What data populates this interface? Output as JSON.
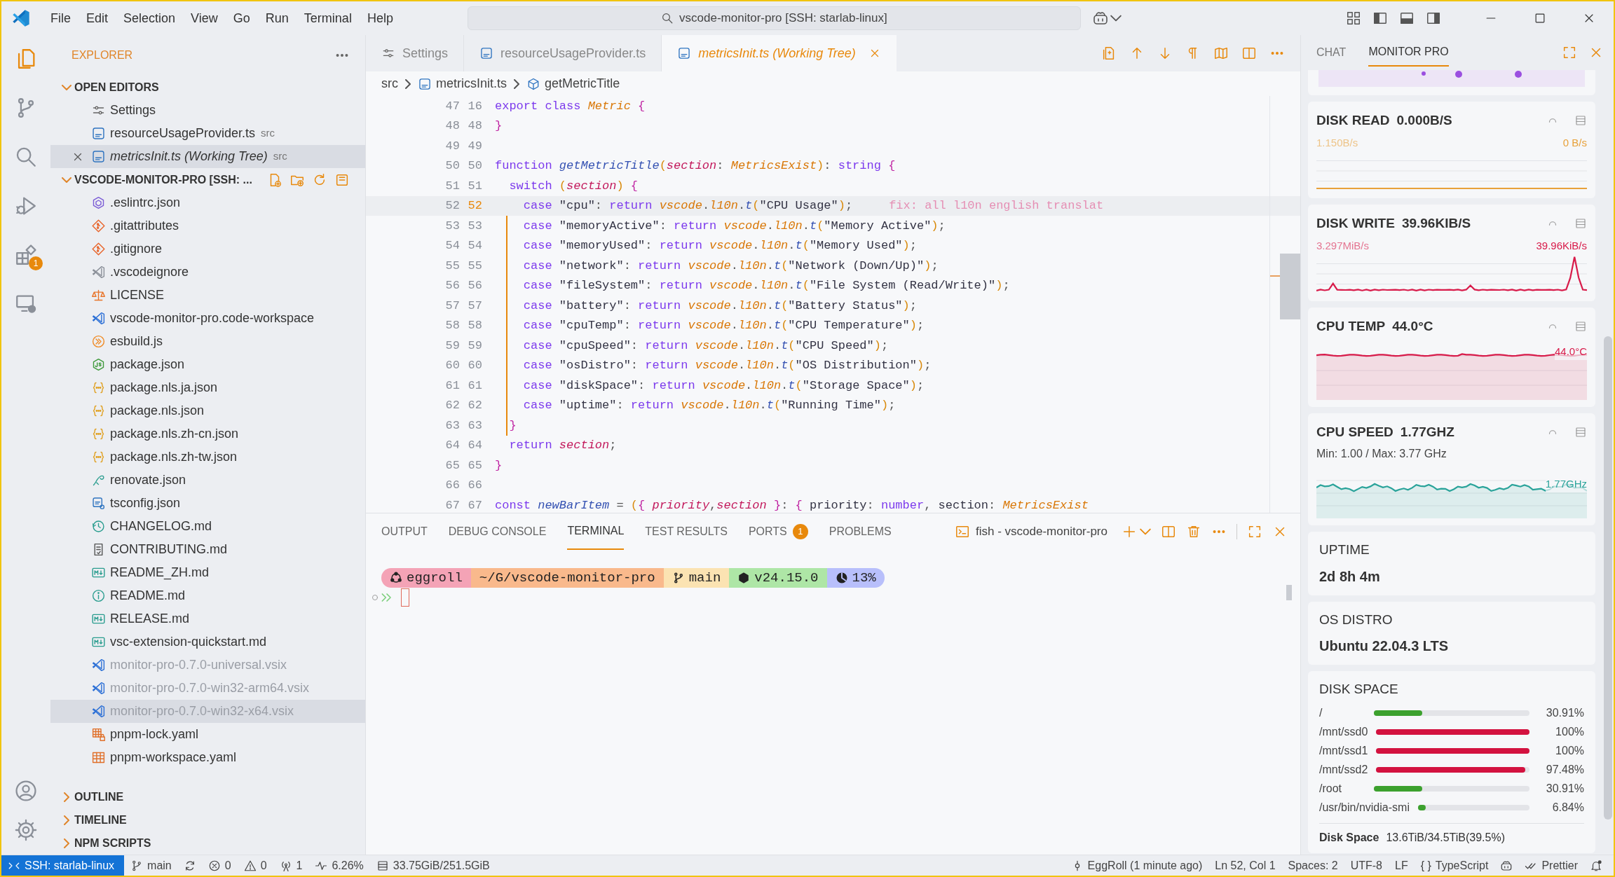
{
  "title_bar": {
    "menu": [
      "File",
      "Edit",
      "Selection",
      "View",
      "Go",
      "Run",
      "Terminal",
      "Help"
    ],
    "search": "vscode-monitor-pro [SSH: starlab-linux]"
  },
  "activity_bar": [
    {
      "kind": "explorer",
      "selected": true
    },
    {
      "kind": "source-control",
      "selected": false
    },
    {
      "kind": "search",
      "selected": false
    },
    {
      "kind": "run-debug",
      "selected": false
    },
    {
      "kind": "extensions",
      "selected": false,
      "badge": "1"
    },
    {
      "kind": "remote",
      "selected": false
    }
  ],
  "sidebar": {
    "title": "EXPLORER",
    "sections": [
      {
        "label": "OPEN EDITORS",
        "expanded": true,
        "items": [
          {
            "kind": "settings",
            "label": "Settings",
            "selected": false,
            "preview": false
          },
          {
            "kind": "typescript",
            "label": "resourceUsageProvider.ts",
            "detail": "src",
            "selected": false,
            "preview": false
          },
          {
            "kind": "typescript",
            "label": "metricsInit.ts (Working Tree)",
            "detail": "src",
            "selected": true,
            "preview": true
          }
        ]
      },
      {
        "label": "VSCODE-MONITOR-PRO [SSH: ...",
        "expanded": true,
        "items": [
          {
            "kind": "eslint",
            "label": ".eslintrc.json",
            "selected": false,
            "dimmed": false
          },
          {
            "kind": "git",
            "label": ".gitattributes",
            "selected": false,
            "dimmed": false
          },
          {
            "kind": "git",
            "label": ".gitignore",
            "selected": false,
            "dimmed": false
          },
          {
            "kind": "vscode-grey",
            "label": ".vscodeignore",
            "selected": false,
            "dimmed": false
          },
          {
            "kind": "license",
            "label": "LICENSE",
            "selected": false,
            "dimmed": false
          },
          {
            "kind": "vscode",
            "label": "vscode-monitor-pro.code-workspace",
            "selected": false,
            "dimmed": false
          },
          {
            "kind": "esbuild",
            "label": "esbuild.js",
            "selected": false,
            "dimmed": false
          },
          {
            "kind": "node",
            "label": "package.json",
            "selected": false,
            "dimmed": false
          },
          {
            "kind": "json",
            "label": "package.nls.ja.json",
            "selected": false,
            "dimmed": false
          },
          {
            "kind": "json",
            "label": "package.nls.json",
            "selected": false,
            "dimmed": false
          },
          {
            "kind": "json",
            "label": "package.nls.zh-cn.json",
            "selected": false,
            "dimmed": false
          },
          {
            "kind": "json",
            "label": "package.nls.zh-tw.json",
            "selected": false,
            "dimmed": false
          },
          {
            "kind": "renovate",
            "label": "renovate.json",
            "selected": false,
            "dimmed": false
          },
          {
            "kind": "tsconfig",
            "label": "tsconfig.json",
            "selected": false,
            "dimmed": false
          },
          {
            "kind": "changelog",
            "label": "CHANGELOG.md",
            "selected": false,
            "dimmed": false
          },
          {
            "kind": "contributing",
            "label": "CONTRIBUTING.md",
            "selected": false,
            "dimmed": false
          },
          {
            "kind": "markdown",
            "label": "README_ZH.md",
            "selected": false,
            "dimmed": false
          },
          {
            "kind": "info",
            "label": "README.md",
            "selected": false,
            "dimmed": false
          },
          {
            "kind": "markdown",
            "label": "RELEASE.md",
            "selected": false,
            "dimmed": false
          },
          {
            "kind": "markdown",
            "label": "vsc-extension-quickstart.md",
            "selected": false,
            "dimmed": false
          },
          {
            "kind": "vscode",
            "label": "monitor-pro-0.7.0-universal.vsix",
            "selected": false,
            "dimmed": true
          },
          {
            "kind": "vscode",
            "label": "monitor-pro-0.7.0-win32-arm64.vsix",
            "selected": false,
            "dimmed": true
          },
          {
            "kind": "vscode",
            "label": "monitor-pro-0.7.0-win32-x64.vsix",
            "selected": true,
            "dimmed": true
          },
          {
            "kind": "table-lock",
            "label": "pnpm-lock.yaml",
            "selected": false,
            "dimmed": false
          },
          {
            "kind": "table",
            "label": "pnpm-workspace.yaml",
            "selected": false,
            "dimmed": false
          }
        ]
      },
      {
        "label": "OUTLINE",
        "expanded": false
      },
      {
        "label": "TIMELINE",
        "expanded": false
      },
      {
        "label": "NPM SCRIPTS",
        "expanded": false
      }
    ]
  },
  "editor": {
    "tabs": [
      {
        "kind": "settings",
        "label": "Settings",
        "selected": false
      },
      {
        "kind": "typescript",
        "label": "resourceUsageProvider.ts",
        "selected": false
      },
      {
        "kind": "typescript",
        "label": "metricsInit.ts (Working Tree)",
        "selected": true
      }
    ],
    "breadcrumb": [
      {
        "kind": "folder",
        "label": "src"
      },
      {
        "kind": "typescript",
        "label": "metricsInit.ts"
      },
      {
        "kind": "symbol",
        "label": "getMetricTitle"
      }
    ],
    "lines": [
      {
        "old": "47",
        "new": "16",
        "current": false,
        "tokens": [
          {
            "text": "export ",
            "kind": "kw"
          },
          {
            "text": "class ",
            "kind": "kw"
          },
          {
            "text": "Metric ",
            "kind": "type"
          },
          {
            "text": "{",
            "kind": "brace"
          }
        ]
      },
      {
        "old": "48",
        "new": "48",
        "current": false,
        "tokens": [
          {
            "text": "}",
            "kind": "brace"
          }
        ]
      },
      {
        "old": "49",
        "new": "49",
        "current": false
      },
      {
        "old": "50",
        "new": "50",
        "current": false,
        "tokens": [
          {
            "text": "function ",
            "kind": "kw"
          },
          {
            "text": "getMetricTitle",
            "kind": "fn"
          },
          {
            "text": "(",
            "kind": "paren"
          },
          {
            "text": "section",
            "kind": "param"
          },
          {
            "text": ": ",
            "kind": "punct"
          },
          {
            "text": "MetricsExist",
            "kind": "type"
          },
          {
            "text": ")",
            "kind": "paren"
          },
          {
            "text": ": ",
            "kind": "punct"
          },
          {
            "text": "string ",
            "kind": "kw"
          },
          {
            "text": "{",
            "kind": "brace"
          }
        ]
      },
      {
        "old": "51",
        "new": "51",
        "current": false,
        "tokens": [
          {
            "text": "  switch ",
            "kind": "kw"
          },
          {
            "text": "(",
            "kind": "paren"
          },
          {
            "text": "section",
            "kind": "param"
          },
          {
            "text": ") ",
            "kind": "paren"
          },
          {
            "text": "{",
            "kind": "brace"
          }
        ]
      },
      {
        "old": "52",
        "new": "52",
        "current": true,
        "annotation": "fix: all l10n english translat",
        "tokens": [
          {
            "text": "    case ",
            "kind": "kw"
          },
          {
            "text": "\"cpu\"",
            "kind": "str"
          },
          {
            "text": ": ",
            "kind": "punct"
          },
          {
            "text": "return ",
            "kind": "kw"
          },
          {
            "text": "vscode",
            "kind": "var"
          },
          {
            "text": ".",
            "kind": "punct"
          },
          {
            "text": "l10n",
            "kind": "var"
          },
          {
            "text": ".",
            "kind": "punct"
          },
          {
            "text": "t",
            "kind": "fn"
          },
          {
            "text": "(",
            "kind": "paren"
          },
          {
            "text": "\"CPU Usage\"",
            "kind": "str"
          },
          {
            "text": ")",
            "kind": "paren"
          },
          {
            "text": ";",
            "kind": "punct"
          }
        ]
      },
      {
        "old": "53",
        "new": "53",
        "current": false,
        "tokens": [
          {
            "text": "    case ",
            "kind": "kw"
          },
          {
            "text": "\"memoryActive\"",
            "kind": "str"
          },
          {
            "text": ": ",
            "kind": "punct"
          },
          {
            "text": "return ",
            "kind": "kw"
          },
          {
            "text": "vscode",
            "kind": "var"
          },
          {
            "text": ".",
            "kind": "punct"
          },
          {
            "text": "l10n",
            "kind": "var"
          },
          {
            "text": ".",
            "kind": "punct"
          },
          {
            "text": "t",
            "kind": "fn"
          },
          {
            "text": "(",
            "kind": "paren"
          },
          {
            "text": "\"Memory Active\"",
            "kind": "str"
          },
          {
            "text": ")",
            "kind": "paren"
          },
          {
            "text": ";",
            "kind": "punct"
          }
        ]
      },
      {
        "old": "54",
        "new": "54",
        "current": false,
        "tokens": [
          {
            "text": "    case ",
            "kind": "kw"
          },
          {
            "text": "\"memoryUsed\"",
            "kind": "str"
          },
          {
            "text": ": ",
            "kind": "punct"
          },
          {
            "text": "return ",
            "kind": "kw"
          },
          {
            "text": "vscode",
            "kind": "var"
          },
          {
            "text": ".",
            "kind": "punct"
          },
          {
            "text": "l10n",
            "kind": "var"
          },
          {
            "text": ".",
            "kind": "punct"
          },
          {
            "text": "t",
            "kind": "fn"
          },
          {
            "text": "(",
            "kind": "paren"
          },
          {
            "text": "\"Memory Used\"",
            "kind": "str"
          },
          {
            "text": ")",
            "kind": "paren"
          },
          {
            "text": ";",
            "kind": "punct"
          }
        ]
      },
      {
        "old": "55",
        "new": "55",
        "current": false,
        "tokens": [
          {
            "text": "    case ",
            "kind": "kw"
          },
          {
            "text": "\"network\"",
            "kind": "str"
          },
          {
            "text": ": ",
            "kind": "punct"
          },
          {
            "text": "return ",
            "kind": "kw"
          },
          {
            "text": "vscode",
            "kind": "var"
          },
          {
            "text": ".",
            "kind": "punct"
          },
          {
            "text": "l10n",
            "kind": "var"
          },
          {
            "text": ".",
            "kind": "punct"
          },
          {
            "text": "t",
            "kind": "fn"
          },
          {
            "text": "(",
            "kind": "paren"
          },
          {
            "text": "\"Network (Down/Up)\"",
            "kind": "str"
          },
          {
            "text": ")",
            "kind": "paren"
          },
          {
            "text": ";",
            "kind": "punct"
          }
        ]
      },
      {
        "old": "56",
        "new": "56",
        "current": false,
        "tokens": [
          {
            "text": "    case ",
            "kind": "kw"
          },
          {
            "text": "\"fileSystem\"",
            "kind": "str"
          },
          {
            "text": ": ",
            "kind": "punct"
          },
          {
            "text": "return ",
            "kind": "kw"
          },
          {
            "text": "vscode",
            "kind": "var"
          },
          {
            "text": ".",
            "kind": "punct"
          },
          {
            "text": "l10n",
            "kind": "var"
          },
          {
            "text": ".",
            "kind": "punct"
          },
          {
            "text": "t",
            "kind": "fn"
          },
          {
            "text": "(",
            "kind": "paren"
          },
          {
            "text": "\"File System (Read/Write)\"",
            "kind": "str"
          },
          {
            "text": ")",
            "kind": "paren"
          },
          {
            "text": ";",
            "kind": "punct"
          }
        ]
      },
      {
        "old": "57",
        "new": "57",
        "current": false,
        "tokens": [
          {
            "text": "    case ",
            "kind": "kw"
          },
          {
            "text": "\"battery\"",
            "kind": "str"
          },
          {
            "text": ": ",
            "kind": "punct"
          },
          {
            "text": "return ",
            "kind": "kw"
          },
          {
            "text": "vscode",
            "kind": "var"
          },
          {
            "text": ".",
            "kind": "punct"
          },
          {
            "text": "l10n",
            "kind": "var"
          },
          {
            "text": ".",
            "kind": "punct"
          },
          {
            "text": "t",
            "kind": "fn"
          },
          {
            "text": "(",
            "kind": "paren"
          },
          {
            "text": "\"Battery Status\"",
            "kind": "str"
          },
          {
            "text": ")",
            "kind": "paren"
          },
          {
            "text": ";",
            "kind": "punct"
          }
        ]
      },
      {
        "old": "58",
        "new": "58",
        "current": false,
        "tokens": [
          {
            "text": "    case ",
            "kind": "kw"
          },
          {
            "text": "\"cpuTemp\"",
            "kind": "str"
          },
          {
            "text": ": ",
            "kind": "punct"
          },
          {
            "text": "return ",
            "kind": "kw"
          },
          {
            "text": "vscode",
            "kind": "var"
          },
          {
            "text": ".",
            "kind": "punct"
          },
          {
            "text": "l10n",
            "kind": "var"
          },
          {
            "text": ".",
            "kind": "punct"
          },
          {
            "text": "t",
            "kind": "fn"
          },
          {
            "text": "(",
            "kind": "paren"
          },
          {
            "text": "\"CPU Temperature\"",
            "kind": "str"
          },
          {
            "text": ")",
            "kind": "paren"
          },
          {
            "text": ";",
            "kind": "punct"
          }
        ]
      },
      {
        "old": "59",
        "new": "59",
        "current": false,
        "tokens": [
          {
            "text": "    case ",
            "kind": "kw"
          },
          {
            "text": "\"cpuSpeed\"",
            "kind": "str"
          },
          {
            "text": ": ",
            "kind": "punct"
          },
          {
            "text": "return ",
            "kind": "kw"
          },
          {
            "text": "vscode",
            "kind": "var"
          },
          {
            "text": ".",
            "kind": "punct"
          },
          {
            "text": "l10n",
            "kind": "var"
          },
          {
            "text": ".",
            "kind": "punct"
          },
          {
            "text": "t",
            "kind": "fn"
          },
          {
            "text": "(",
            "kind": "paren"
          },
          {
            "text": "\"CPU Speed\"",
            "kind": "str"
          },
          {
            "text": ")",
            "kind": "paren"
          },
          {
            "text": ";",
            "kind": "punct"
          }
        ]
      },
      {
        "old": "60",
        "new": "60",
        "current": false,
        "tokens": [
          {
            "text": "    case ",
            "kind": "kw"
          },
          {
            "text": "\"osDistro\"",
            "kind": "str"
          },
          {
            "text": ": ",
            "kind": "punct"
          },
          {
            "text": "return ",
            "kind": "kw"
          },
          {
            "text": "vscode",
            "kind": "var"
          },
          {
            "text": ".",
            "kind": "punct"
          },
          {
            "text": "l10n",
            "kind": "var"
          },
          {
            "text": ".",
            "kind": "punct"
          },
          {
            "text": "t",
            "kind": "fn"
          },
          {
            "text": "(",
            "kind": "paren"
          },
          {
            "text": "\"OS Distribution\"",
            "kind": "str"
          },
          {
            "text": ")",
            "kind": "paren"
          },
          {
            "text": ";",
            "kind": "punct"
          }
        ]
      },
      {
        "old": "61",
        "new": "61",
        "current": false,
        "tokens": [
          {
            "text": "    case ",
            "kind": "kw"
          },
          {
            "text": "\"diskSpace\"",
            "kind": "str"
          },
          {
            "text": ": ",
            "kind": "punct"
          },
          {
            "text": "return ",
            "kind": "kw"
          },
          {
            "text": "vscode",
            "kind": "var"
          },
          {
            "text": ".",
            "kind": "punct"
          },
          {
            "text": "l10n",
            "kind": "var"
          },
          {
            "text": ".",
            "kind": "punct"
          },
          {
            "text": "t",
            "kind": "fn"
          },
          {
            "text": "(",
            "kind": "paren"
          },
          {
            "text": "\"Storage Space\"",
            "kind": "str"
          },
          {
            "text": ")",
            "kind": "paren"
          },
          {
            "text": ";",
            "kind": "punct"
          }
        ]
      },
      {
        "old": "62",
        "new": "62",
        "current": false,
        "tokens": [
          {
            "text": "    case ",
            "kind": "kw"
          },
          {
            "text": "\"uptime\"",
            "kind": "str"
          },
          {
            "text": ": ",
            "kind": "punct"
          },
          {
            "text": "return ",
            "kind": "kw"
          },
          {
            "text": "vscode",
            "kind": "var"
          },
          {
            "text": ".",
            "kind": "punct"
          },
          {
            "text": "l10n",
            "kind": "var"
          },
          {
            "text": ".",
            "kind": "punct"
          },
          {
            "text": "t",
            "kind": "fn"
          },
          {
            "text": "(",
            "kind": "paren"
          },
          {
            "text": "\"Running Time\"",
            "kind": "str"
          },
          {
            "text": ")",
            "kind": "paren"
          },
          {
            "text": ";",
            "kind": "punct"
          }
        ]
      },
      {
        "old": "63",
        "new": "63",
        "current": false,
        "tokens": [
          {
            "text": "  }",
            "kind": "brace"
          }
        ]
      },
      {
        "old": "64",
        "new": "64",
        "current": false,
        "tokens": [
          {
            "text": "  return ",
            "kind": "kw"
          },
          {
            "text": "section",
            "kind": "param"
          },
          {
            "text": ";",
            "kind": "punct"
          }
        ]
      },
      {
        "old": "65",
        "new": "65",
        "current": false,
        "tokens": [
          {
            "text": "}",
            "kind": "brace"
          }
        ]
      },
      {
        "old": "66",
        "new": "66",
        "current": false
      },
      {
        "old": "67",
        "new": "67",
        "current": false,
        "tokens": [
          {
            "text": "const ",
            "kind": "kw"
          },
          {
            "text": "newBarItem",
            "kind": "fn"
          },
          {
            "text": " = ",
            "kind": "punct"
          },
          {
            "text": "(",
            "kind": "paren"
          },
          {
            "text": "{ ",
            "kind": "brace"
          },
          {
            "text": "priority",
            "kind": "param"
          },
          {
            "text": ",",
            "kind": "punct"
          },
          {
            "text": "section ",
            "kind": "param"
          },
          {
            "text": "}",
            "kind": "brace"
          },
          {
            "text": ": ",
            "kind": "punct"
          },
          {
            "text": "{ ",
            "kind": "brace"
          },
          {
            "text": "priority",
            "kind": "prop"
          },
          {
            "text": ": ",
            "kind": "punct"
          },
          {
            "text": "number",
            "kind": "kw"
          },
          {
            "text": ", ",
            "kind": "punct"
          },
          {
            "text": "section",
            "kind": "prop"
          },
          {
            "text": ": ",
            "kind": "punct"
          },
          {
            "text": "MetricsExist",
            "kind": "type"
          }
        ]
      }
    ]
  },
  "panel": {
    "tabs": [
      {
        "label": "OUTPUT",
        "selected": false
      },
      {
        "label": "DEBUG CONSOLE",
        "selected": false
      },
      {
        "label": "TERMINAL",
        "selected": true
      },
      {
        "label": "TEST RESULTS",
        "selected": false
      },
      {
        "label": "PORTS",
        "selected": false,
        "badge": "1"
      },
      {
        "label": "PROBLEMS",
        "selected": false
      }
    ],
    "terminal_title": "fish - vscode-monitor-pro",
    "prompt": [
      {
        "kind": "user",
        "text": "eggroll",
        "color": "#f4a3b6"
      },
      {
        "kind": "path",
        "text": "~/G/vscode-monitor-pro",
        "color": "#f9b98c"
      },
      {
        "kind": "branch",
        "text": "main",
        "color": "#fbe3b2"
      },
      {
        "kind": "node",
        "text": "v24.15.0",
        "color": "#aee6a6"
      },
      {
        "kind": "pie",
        "text": "13%",
        "color": "#b8bffb"
      }
    ]
  },
  "right_panel": {
    "tabs": [
      {
        "label": "CHAT",
        "selected": false
      },
      {
        "label": "MONITOR PRO",
        "selected": true
      }
    ],
    "cards": [
      {
        "kind": "chart_cut",
        "color": "#9b4fe0"
      },
      {
        "kind": "chart",
        "title": "DISK READ",
        "value": "0.000B/S",
        "max_label": "1.150B/s",
        "current_label": "0 B/s",
        "color": "#e8a13a",
        "filled": false
      },
      {
        "kind": "chart",
        "title": "DISK WRITE",
        "value": "39.96KIB/S",
        "max_label": "3.297MiB/s",
        "current_label": "39.96KiB/s",
        "color": "#d81b4a",
        "filled": false
      },
      {
        "kind": "chart",
        "title": "CPU TEMP",
        "value": "44.0°C",
        "end_label": "44.0°C",
        "color": "#d81b4a",
        "filled": true
      },
      {
        "kind": "chart",
        "title": "CPU SPEED",
        "value": "1.77GHZ",
        "subtitle": "Min: 1.00 / Max: 3.77 GHz",
        "end_label": "1.77GHz",
        "color": "#2aa39a",
        "filled": true
      },
      {
        "kind": "text",
        "title": "UPTIME",
        "value": "2d 8h 4m"
      },
      {
        "kind": "text",
        "title": "OS DISTRO",
        "value": "Ubuntu 22.04.3 LTS"
      },
      {
        "kind": "disk",
        "title": "DISK SPACE",
        "rows": [
          {
            "mount": "/",
            "level": 0.3091,
            "percent": "30.91%",
            "color": "#3ca12e"
          },
          {
            "mount": "/mnt/ssd0",
            "level": 1,
            "percent": "100%",
            "color": "#d3123f"
          },
          {
            "mount": "/mnt/ssd1",
            "level": 1,
            "percent": "100%",
            "color": "#d3123f"
          },
          {
            "mount": "/mnt/ssd2",
            "level": 0.9748,
            "percent": "97.48%",
            "color": "#d3123f"
          },
          {
            "mount": "/root",
            "level": 0.3091,
            "percent": "30.91%",
            "color": "#3ca12e"
          },
          {
            "mount": "/usr/bin/nvidia-smi",
            "level": 0.0684,
            "percent": "6.84%",
            "color": "#3ca12e"
          }
        ],
        "footer_label": "Disk Space",
        "footer_value": "13.6TiB/34.5TiB(39.5%)"
      }
    ]
  },
  "status_bar": {
    "left": [
      {
        "kind": "remote",
        "text": "SSH: starlab-linux"
      },
      {
        "kind": "branch",
        "text": "main"
      },
      {
        "kind": "sync"
      },
      {
        "kind": "errors",
        "text": "0"
      },
      {
        "kind": "warnings",
        "text": "0"
      },
      {
        "kind": "ports",
        "text": "1"
      },
      {
        "kind": "pulse",
        "text": "6.26%"
      },
      {
        "kind": "memory",
        "text": "33.75GiB/251.5GiB"
      }
    ],
    "right": [
      {
        "kind": "blame",
        "text": "EggRoll (1 minute ago)"
      },
      {
        "kind": "plain",
        "text": "Ln 52, Col 1"
      },
      {
        "kind": "plain",
        "text": "Spaces: 2"
      },
      {
        "kind": "plain",
        "text": "UTF-8"
      },
      {
        "kind": "plain",
        "text": "LF"
      },
      {
        "kind": "language",
        "icon": "{ }",
        "text": "TypeScript"
      },
      {
        "kind": "copilot"
      },
      {
        "kind": "prettier",
        "text": "Prettier"
      },
      {
        "kind": "bell"
      }
    ]
  }
}
